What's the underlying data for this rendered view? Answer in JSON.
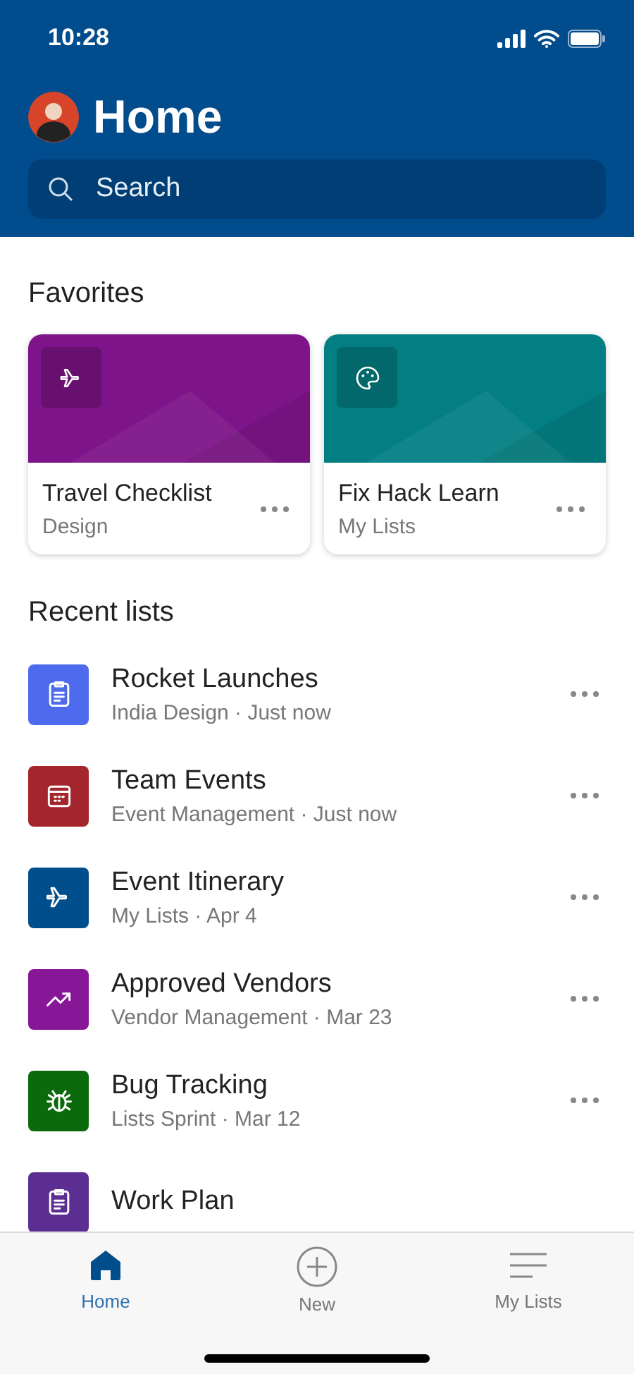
{
  "status_bar": {
    "time": "10:28"
  },
  "header": {
    "title": "Home",
    "search": {
      "placeholder": "Search"
    }
  },
  "favorites": {
    "heading": "Favorites",
    "cards": [
      {
        "title": "Travel Checklist",
        "subtitle": "Design",
        "color": "#7e1489",
        "kind": "airplane"
      },
      {
        "title": "Fix Hack Learn",
        "subtitle": "My Lists",
        "color": "#037f83",
        "kind": "palette"
      }
    ]
  },
  "recent": {
    "heading": "Recent lists",
    "items": [
      {
        "title": "Rocket Launches",
        "subtitle": "India Design · Just now",
        "color": "#4f6bed",
        "kind": "clipboard"
      },
      {
        "title": "Team Events",
        "subtitle": "Event Management · Just now",
        "color": "#a4262c",
        "kind": "calendar"
      },
      {
        "title": "Event Itinerary",
        "subtitle": "My Lists · Apr 4",
        "color": "#004e8c",
        "kind": "airplane"
      },
      {
        "title": "Approved Vendors",
        "subtitle": "Vendor Management · Mar 23",
        "color": "#881798",
        "kind": "trend"
      },
      {
        "title": "Bug Tracking",
        "subtitle": "Lists Sprint · Mar 12",
        "color": "#0b6a0b",
        "kind": "bug"
      },
      {
        "title": "Work Plan",
        "color": "#5c2e91",
        "kind": "clipboard"
      }
    ]
  },
  "tab_bar": [
    {
      "label": "Home",
      "selected": true
    },
    {
      "label": "New",
      "selected": false
    },
    {
      "label": "My Lists",
      "selected": false
    }
  ]
}
